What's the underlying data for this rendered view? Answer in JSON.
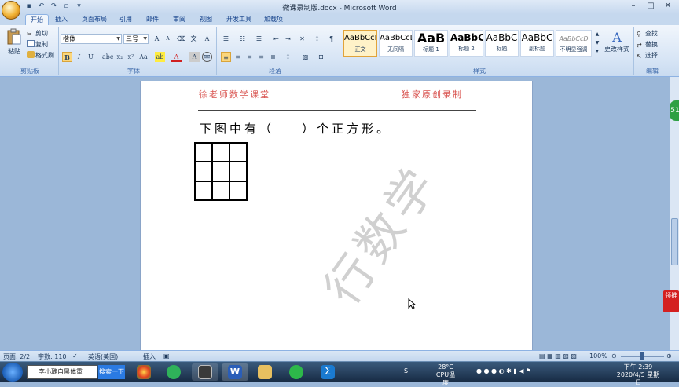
{
  "window": {
    "title": "微课录制版.docx - Microsoft Word"
  },
  "tabs": [
    "开始",
    "插入",
    "页面布局",
    "引用",
    "邮件",
    "审阅",
    "视图",
    "开发工具",
    "加载项"
  ],
  "clipboard": {
    "paste": "粘贴",
    "cut": "剪切",
    "copy": "复制",
    "format_painter": "格式刷",
    "label": "剪贴板"
  },
  "font": {
    "name": "楷体",
    "size": "三号",
    "label": "字体"
  },
  "paragraph": {
    "label": "段落"
  },
  "styles": {
    "label": "样式",
    "items": [
      {
        "sample": "AaBbCcD",
        "name": "正文"
      },
      {
        "sample": "AaBbCcD",
        "name": "无间隔"
      },
      {
        "sample": "AaB",
        "name": "标题 1"
      },
      {
        "sample": "AaBbC",
        "name": "标题 2"
      },
      {
        "sample": "AaBbC",
        "name": "标题"
      },
      {
        "sample": "AaBbC",
        "name": "副标题"
      },
      {
        "sample": "AaBbCcD",
        "name": "不明显强调"
      }
    ],
    "change_styles": "更改样式"
  },
  "editing": {
    "find": "查找",
    "replace": "替换",
    "select": "选择",
    "label": "编辑"
  },
  "document": {
    "header_left": "徐老师数学课堂",
    "header_right": "独家原创录制",
    "question": "下图中有（    ）个正方形。",
    "watermark": "行数学"
  },
  "side": {
    "badge": "领推",
    "bubble": "51"
  },
  "statusbar": {
    "page": "页面: 2/2",
    "words": "字数: 110",
    "language": "英语(美国)",
    "mode": "插入",
    "zoom": "100%"
  },
  "taskbar": {
    "search_text": "李小璐自黑体重",
    "search_button": "搜索一下",
    "weather_temp": "28°C",
    "weather_label": "CPU温度",
    "time": "下午 2:39",
    "date": "2020/4/5 星期日"
  }
}
